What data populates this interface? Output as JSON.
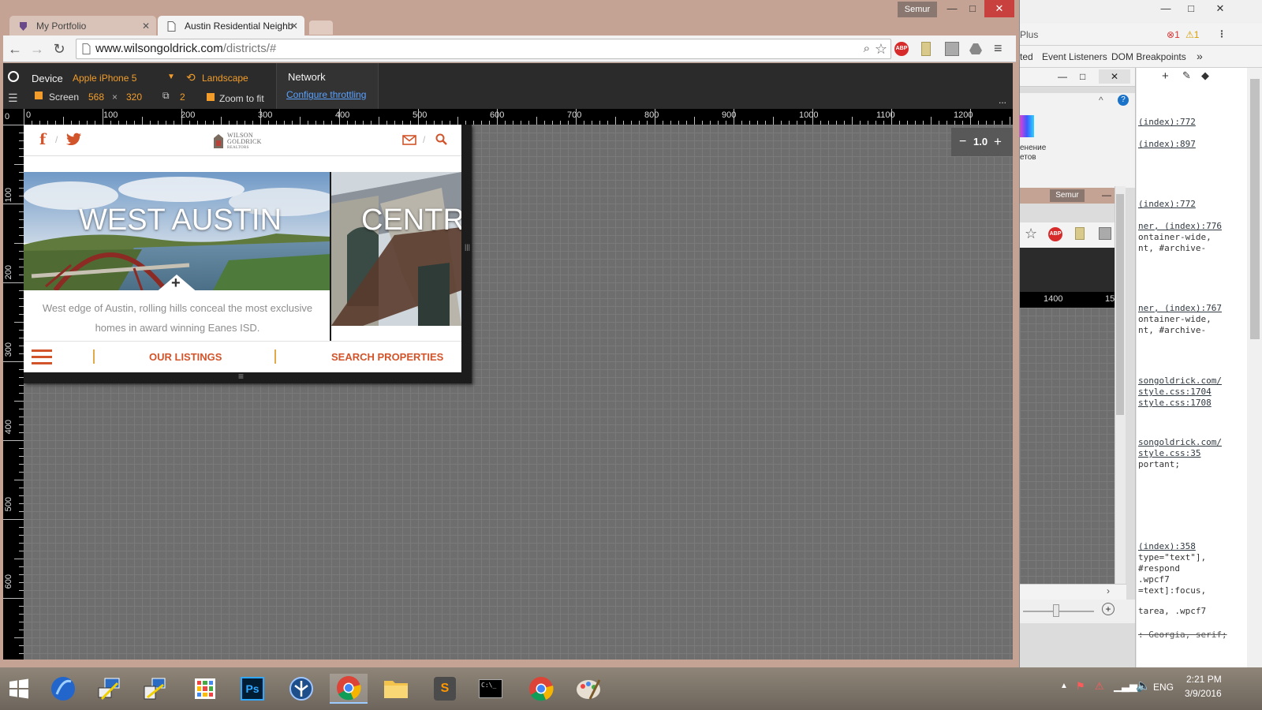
{
  "browser": {
    "user": "Semur",
    "tabs": [
      {
        "label": "My Portfolio"
      },
      {
        "label": "Austin Residential Neighb"
      }
    ],
    "url": {
      "domain": "www.wilsongoldrick.com",
      "path": "/districts/#"
    },
    "abp_label": "ABP"
  },
  "emulation": {
    "device_label": "Device",
    "device_name": "Apple iPhone 5",
    "orientation": "Landscape",
    "screen_label": "Screen",
    "screen_width": "568",
    "screen_x": "×",
    "screen_height": "320",
    "dpr": "2",
    "zoom_to_fit": "Zoom to fit",
    "network_label": "Network",
    "throttling_link": "Configure throttling",
    "more": "...",
    "zoom_value": "1.0",
    "zoom_minus": "−",
    "zoom_plus": "+",
    "ruler_top": [
      "0",
      "100",
      "200",
      "300",
      "400",
      "500",
      "600",
      "700",
      "800",
      "900",
      "1000",
      "1100",
      "1200"
    ],
    "ruler_left": [
      "0",
      "100",
      "200",
      "300",
      "400",
      "500",
      "600"
    ]
  },
  "site": {
    "logo_line1": "WILSON",
    "logo_line2": "GOLDRICK",
    "logo_line3": "REALTORS",
    "card_west_title": "WEST AUSTIN",
    "card_west_text": "West edge of Austin, rolling hills conceal the most exclusive homes in award winning Eanes ISD.",
    "card_central_title": "CENTRA",
    "card_plus": "+",
    "footer_listings": "OUR LISTINGS",
    "footer_search": "SEARCH PROPERTIES",
    "bottom_handle": "≡",
    "side_handle": "|||"
  },
  "devtools": {
    "title_fragment": "Plus",
    "errors": "1",
    "warnings": "1",
    "tab_fragment": "ted",
    "tab_event_listeners": "Event Listeners",
    "tab_dom_breakpoints": "DOM Breakpoints",
    "tab_more": "»",
    "user": "Semur",
    "inner_ruler": "1400",
    "inner_ruler_b": "15",
    "ru_line1": "енение",
    "ru_line2": "етов",
    "code_lines": [
      "(index):772",
      "(index):897",
      "(index):772",
      "ner, (index):776",
      "ontainer-wide,",
      "nt, #archive-",
      "ner, (index):767",
      "ontainer-wide,",
      "nt, #archive-",
      "songoldrick.com/",
      "style.css:1704",
      "style.css:1708",
      "songoldrick.com/",
      "style.css:35",
      "portant;",
      "(index):358",
      "type=\"text\"],",
      "#respond",
      ".wpcf7",
      "=text]:focus,",
      "tarea, .wpcf7",
      ": Georgia, serif;"
    ]
  },
  "taskbar": {
    "time": "2:21 PM",
    "date": "3/9/2016",
    "lang": "ENG",
    "apps": [
      "windows-start",
      "browser-app",
      "network-app",
      "network-app-2",
      "apps-grid",
      "photoshop",
      "settings-app",
      "chrome",
      "file-explorer",
      "sublime-text",
      "command-prompt",
      "chrome-2",
      "paint"
    ],
    "ps_label": "Ps",
    "cmd_label": "C:\\_",
    "sublime_label": "S"
  },
  "colors": {
    "brand_orange": "#d2542b",
    "emu_orange": "#f29d2b",
    "link_blue": "#5aa2ff"
  }
}
